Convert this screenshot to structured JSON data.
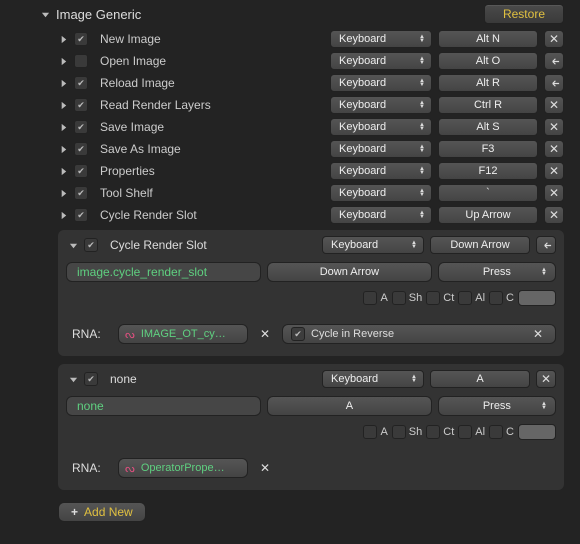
{
  "group": {
    "label": "Image Generic",
    "restore": "Restore"
  },
  "rows": [
    {
      "checked": true,
      "label": "New Image",
      "mapType": "Keyboard",
      "key": "Alt N",
      "tail": "x"
    },
    {
      "checked": false,
      "label": "Open Image",
      "mapType": "Keyboard",
      "key": "Alt O",
      "tail": "back"
    },
    {
      "checked": true,
      "label": "Reload Image",
      "mapType": "Keyboard",
      "key": "Alt R",
      "tail": "back"
    },
    {
      "checked": true,
      "label": "Read Render Layers",
      "mapType": "Keyboard",
      "key": "Ctrl R",
      "tail": "x"
    },
    {
      "checked": true,
      "label": "Save Image",
      "mapType": "Keyboard",
      "key": "Alt S",
      "tail": "x"
    },
    {
      "checked": true,
      "label": "Save As Image",
      "mapType": "Keyboard",
      "key": "F3",
      "tail": "x"
    },
    {
      "checked": true,
      "label": "Properties",
      "mapType": "Keyboard",
      "key": "F12",
      "tail": "x"
    },
    {
      "checked": true,
      "label": "Tool Shelf",
      "mapType": "Keyboard",
      "key": "`",
      "tail": "x"
    },
    {
      "checked": true,
      "label": "Cycle Render Slot",
      "mapType": "Keyboard",
      "key": "Up Arrow",
      "tail": "x"
    }
  ],
  "panel1": {
    "checked": true,
    "label": "Cycle Render Slot",
    "mapType": "Keyboard",
    "key": "Down Arrow",
    "tail": "back",
    "operator": "image.cycle_render_slot",
    "event": "Down Arrow",
    "action": "Press",
    "mods": {
      "A": false,
      "Sh": false,
      "Ct": false,
      "Al": false,
      "C": false
    },
    "rnaLabel": "RNA:",
    "rna": "IMAGE_OT_cy…",
    "reverseLabel": "Cycle in Reverse",
    "reverseChecked": true
  },
  "panel2": {
    "checked": true,
    "label": "none",
    "mapType": "Keyboard",
    "key": "A",
    "tail": "x",
    "operator": "none",
    "event": "A",
    "action": "Press",
    "mods": {
      "A": false,
      "Sh": false,
      "Ct": false,
      "Al": false,
      "C": false
    },
    "rnaLabel": "RNA:",
    "rna": "OperatorPrope…"
  },
  "addNew": "Add New",
  "modLabels": {
    "A": "A",
    "Sh": "Sh",
    "Ct": "Ct",
    "Al": "Al",
    "C": "C"
  }
}
